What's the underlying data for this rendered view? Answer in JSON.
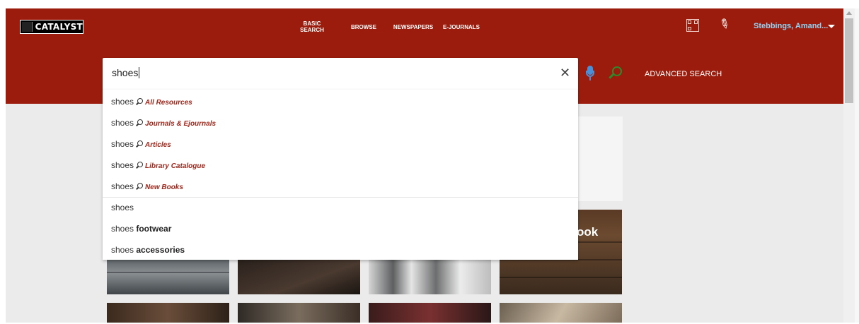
{
  "header": {
    "logo_text": "CATALYST",
    "nav": [
      {
        "label": "BASIC SEARCH"
      },
      {
        "label": "BROWSE"
      },
      {
        "label": "NEWSPAPERS"
      },
      {
        "label": "E-JOURNALS"
      }
    ],
    "user_name": "Stebbings, Amand..."
  },
  "search": {
    "query": "shoes",
    "advanced_label": "ADVANCED SEARCH"
  },
  "suggestions": {
    "scoped": [
      {
        "term": "shoes",
        "scope": "All Resources"
      },
      {
        "term": "shoes",
        "scope": "Journals & Ejournals"
      },
      {
        "term": "shoes",
        "scope": "Articles"
      },
      {
        "term": "shoes",
        "scope": "Library Catalogue"
      },
      {
        "term": "shoes",
        "scope": "New Books"
      }
    ],
    "completions": [
      {
        "prefix": "shoes",
        "rest": ""
      },
      {
        "prefix": "shoes ",
        "rest": "footwear"
      },
      {
        "prefix": "shoes ",
        "rest": "accessories"
      }
    ]
  },
  "tiles": {
    "partial_label": "ook"
  },
  "colors": {
    "brand": "#9b1c0c",
    "scope_text": "#a0261a",
    "user_link": "#8fd4f7",
    "search_go": "#2c8a2c",
    "mic": "#4a90d9"
  },
  "icons": [
    "qr-code-icon",
    "pin-icon",
    "chevron-down-icon",
    "clear-icon",
    "microphone-icon",
    "search-icon"
  ]
}
